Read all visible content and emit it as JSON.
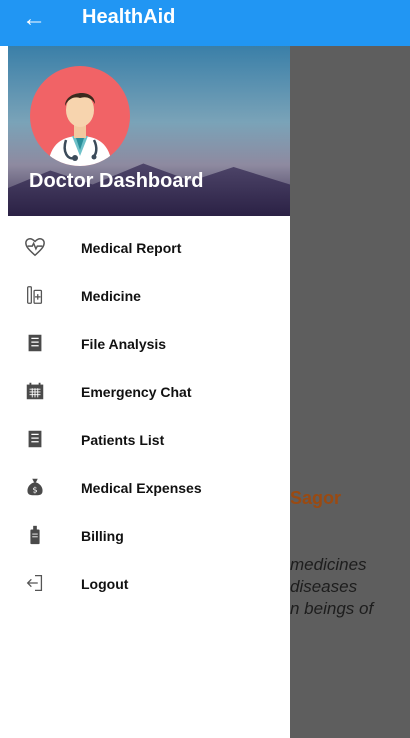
{
  "app_bar": {
    "back_icon": "arrow-left-icon",
    "title": "HealthAid",
    "color": "#2196f3"
  },
  "drawer": {
    "header": {
      "title": "Doctor Dashboard",
      "avatar_icon": "doctor-avatar-icon"
    },
    "items": [
      {
        "label": "Medical Report",
        "icon": "heartbeat-icon"
      },
      {
        "label": "Medicine",
        "icon": "medicine-icon"
      },
      {
        "label": "File Analysis",
        "icon": "file-list-icon"
      },
      {
        "label": "Emergency Chat",
        "icon": "calendar-chat-icon"
      },
      {
        "label": "Patients List",
        "icon": "list-icon"
      },
      {
        "label": "Medical Expenses",
        "icon": "money-bag-icon"
      },
      {
        "label": "Billing",
        "icon": "billing-icon"
      },
      {
        "label": "Logout",
        "icon": "logout-icon"
      }
    ]
  },
  "background_page": {
    "name_fragment": "Sagor",
    "text_lines": [
      " medicines",
      "diseases",
      "n beings of"
    ]
  }
}
